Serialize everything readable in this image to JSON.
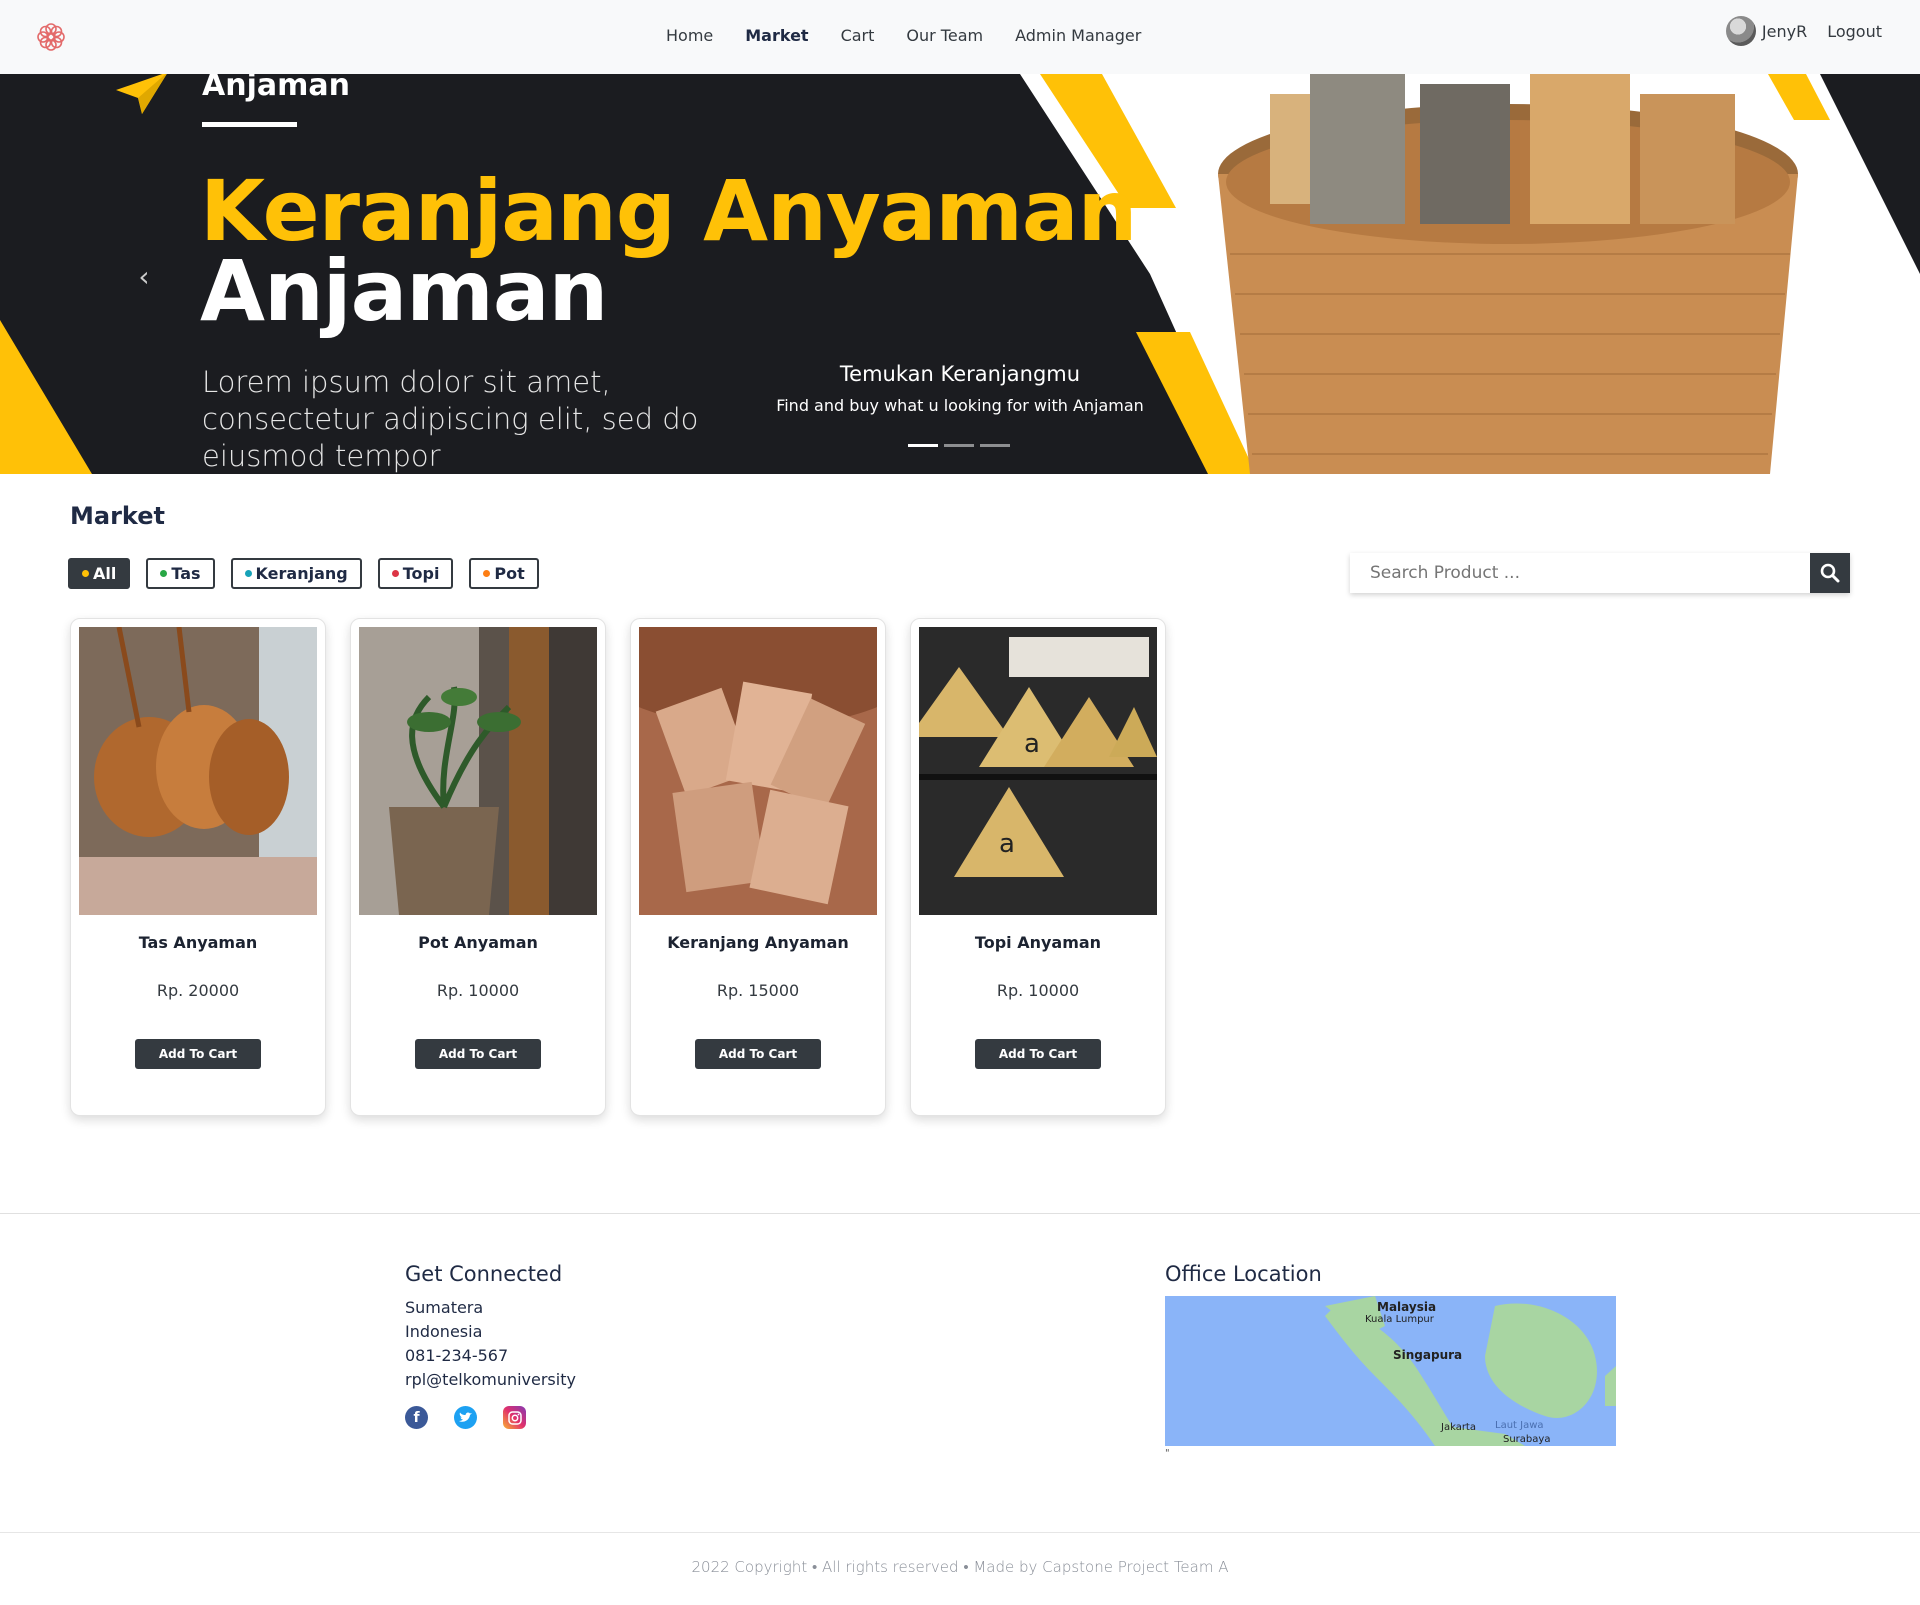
{
  "nav": {
    "links": [
      "Home",
      "Market",
      "Cart",
      "Our Team",
      "Admin Manager"
    ],
    "active": "Market",
    "user": "JenyR",
    "logout": "Logout"
  },
  "hero": {
    "brand": "Anjaman",
    "title_line1": "Keranjang Anyaman",
    "title_line2": "Anjaman",
    "text": "Lorem ipsum dolor sit amet, consectetur adipiscing elit, sed do eiusmod tempor",
    "caption_title": "Temukan Keranjangmu",
    "caption_text": "Find and buy what u looking for with Anjaman",
    "slides": 3,
    "active_slide": 1
  },
  "market": {
    "title": "Market",
    "filters": [
      {
        "label": "All",
        "color": "#ffc107",
        "active": true
      },
      {
        "label": "Tas",
        "color": "#28a745",
        "active": false
      },
      {
        "label": "Keranjang",
        "color": "#17a2b8",
        "active": false
      },
      {
        "label": "Topi",
        "color": "#dc3545",
        "active": false
      },
      {
        "label": "Pot",
        "color": "#fd7e14",
        "active": false
      }
    ],
    "search_placeholder": "Search Product ...",
    "products": [
      {
        "name": "Tas Anyaman",
        "price": "Rp. 20000",
        "button": "Add To Cart"
      },
      {
        "name": "Pot Anyaman",
        "price": "Rp. 10000",
        "button": "Add To Cart"
      },
      {
        "name": "Keranjang Anyaman",
        "price": "Rp. 15000",
        "button": "Add To Cart"
      },
      {
        "name": "Topi Anyaman",
        "price": "Rp. 10000",
        "button": "Add To Cart"
      }
    ]
  },
  "footer": {
    "connected_title": "Get Connected",
    "lines": [
      "Sumatera",
      "Indonesia",
      "081-234-567",
      "rpl@telkomuniversity"
    ],
    "location_title": "Office Location",
    "map_labels": [
      "Malaysia",
      "Kuala Lumpur",
      "Singapura",
      "Jakarta",
      "Laut Jawa",
      "Surabaya"
    ],
    "map_note": "\"",
    "copyright": "2022 Copyright • All rights reserved • Made by Capstone Project Team A"
  },
  "colors": {
    "accent": "#ffc107",
    "dark": "#343a40",
    "hero_bg": "#1b1c20"
  }
}
